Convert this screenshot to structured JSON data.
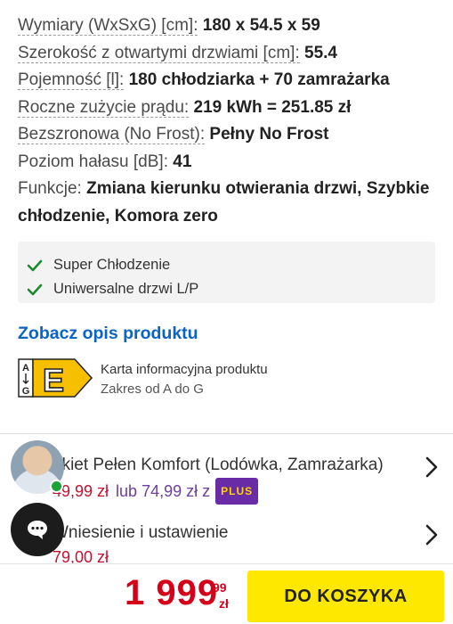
{
  "specs": [
    {
      "label": "Wymiary (WxSxG) [cm]:",
      "value": "180 x 54.5 x 59"
    },
    {
      "label": "Szerokość z otwartymi drzwiami [cm]:",
      "value": "55.4"
    },
    {
      "label": "Pojemność [l]:",
      "value": "180 chłodziarka + 70 zamrażarka"
    },
    {
      "label": "Roczne zużycie prądu:",
      "value": "219 kWh = 251.85 zł"
    },
    {
      "label": "Bezszronowa (No Frost):",
      "value": "Pełny No Frost"
    },
    {
      "label": "Poziom hałasu [dB]:",
      "value": "41"
    },
    {
      "label": "Funkcje:",
      "value": "Zmiana kierunku otwierania drzwi, Szybkie chłodzenie, Komora zero"
    }
  ],
  "features": [
    "Super Chłodzenie",
    "Uniwersalne drzwi L/P"
  ],
  "product_link": "Zobacz opis produktu",
  "energy": {
    "class": "E",
    "range_top": "A",
    "range_bottom": "G",
    "title": "Karta informacyjna produktu",
    "subtitle": "Zakres od A do G"
  },
  "services": [
    {
      "name": "akiet Pełen Komfort (Lodówka, Zamrażarka)",
      "price": "49,99 zł",
      "alt_price": "lub 74,99 zł z",
      "badge": "PLUS"
    },
    {
      "name": "Wniesienie i ustawienie",
      "price": "79,00 zł"
    }
  ],
  "footer": {
    "price_main": "1 999",
    "price_cents": "99",
    "currency": "zł",
    "cart_label": "DO KOSZYKA"
  },
  "colors": {
    "link": "#0b63c5",
    "price": "#d4001a",
    "cart_button": "#ffe800",
    "check": "#1e8a2e",
    "plus_badge": "#6a2ba6"
  }
}
